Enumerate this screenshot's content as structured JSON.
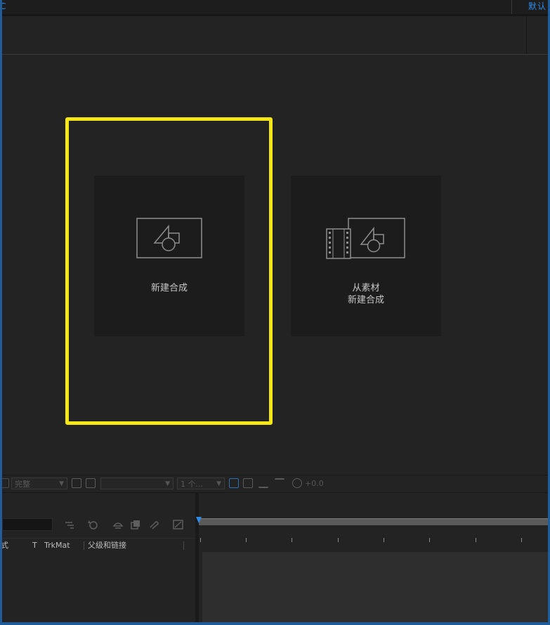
{
  "top_bar": {
    "left_fragment": "C",
    "right_fragment": "默认"
  },
  "cards": {
    "new_composition": {
      "label": "新建合成"
    },
    "new_from_footage": {
      "label_line1": "从素材",
      "label_line2": "新建合成"
    }
  },
  "viewer_footer": {
    "resolution": "完整",
    "views": "1 个...",
    "exposure": "+0.0"
  },
  "timeline": {
    "columns": {
      "mode": "式",
      "t": "T",
      "trkmat": "TrkMat",
      "parent": "父级和链接"
    }
  },
  "colors": {
    "highlight": "#f5e615",
    "accent": "#2d8ceb",
    "panel_bg": "#232323",
    "card_bg": "#1c1c1c"
  },
  "icons": {
    "new_composition": "composition-shapes-icon",
    "new_from_footage": "film-strip-composition-icon"
  }
}
